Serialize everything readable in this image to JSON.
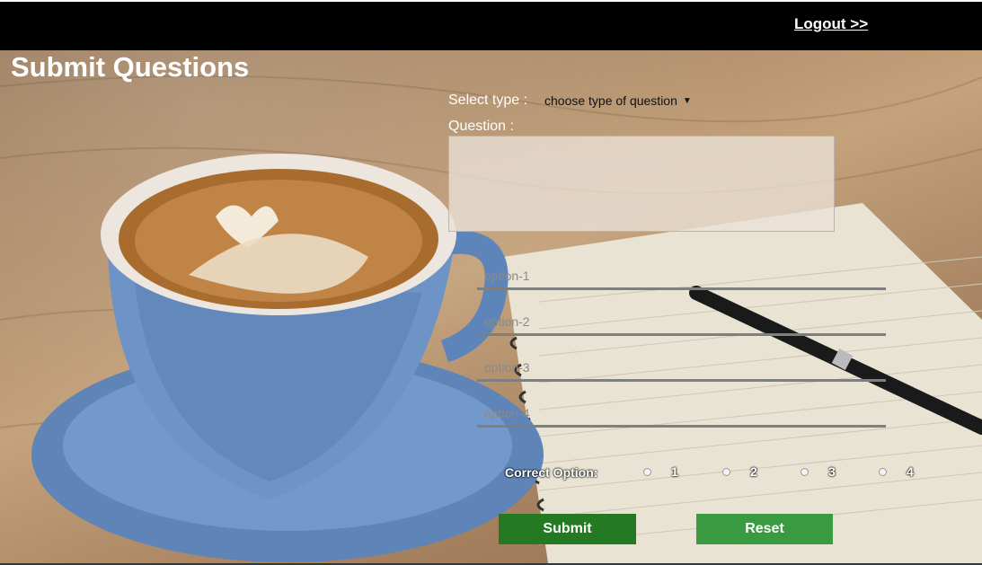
{
  "header": {
    "logout_label": "Logout >>"
  },
  "page": {
    "title": "Submit Questions"
  },
  "form": {
    "select_type_label": "Select type :",
    "select_type_value": "choose type of question",
    "question_label": "Question :",
    "question_value": "",
    "options": [
      {
        "placeholder": "option-1",
        "value": ""
      },
      {
        "placeholder": "option-2",
        "value": ""
      },
      {
        "placeholder": "option-3",
        "value": ""
      },
      {
        "placeholder": "option-4",
        "value": ""
      }
    ],
    "correct_option_label": "Correct Option:",
    "correct_option_choices": [
      "1",
      "2",
      "3",
      "4"
    ],
    "submit_label": "Submit",
    "reset_label": "Reset"
  },
  "colors": {
    "topbar": "#000000",
    "submit": "#237a23",
    "reset": "#3a9a42"
  }
}
